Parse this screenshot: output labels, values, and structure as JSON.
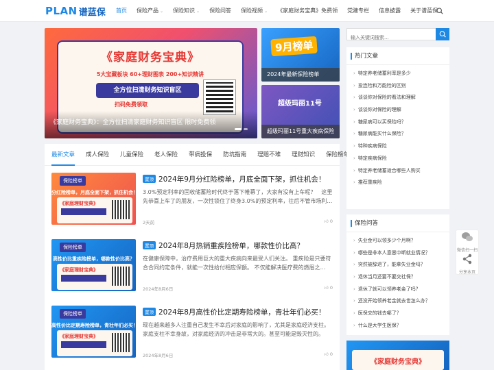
{
  "header": {
    "logo_plan": "PLAN",
    "logo_cn": "谱蓝保",
    "nav": [
      {
        "label": "首页",
        "caret": false,
        "active": true
      },
      {
        "label": "保险产品",
        "caret": true
      },
      {
        "label": "保险知识",
        "caret": true
      },
      {
        "label": "保险问答",
        "caret": false
      },
      {
        "label": "保险视频",
        "caret": true
      },
      {
        "label": "《家庭财务宝典》免费领",
        "caret": false
      },
      {
        "label": "党建专栏",
        "caret": false
      },
      {
        "label": "信息披露",
        "caret": false
      },
      {
        "label": "关于谱蓝保",
        "caret": true
      }
    ]
  },
  "slider": {
    "headline": "《家庭财务宝典》",
    "tagline": "5大宝藏板块 60+理财图表 200+知识精讲",
    "pill": "全方位扫清财务知识盲区",
    "sub": "扫码免费领取",
    "caption": "《家庭财务宝典》：全方位扫清家庭财务知识盲区 限时免费领"
  },
  "side_cards": [
    {
      "big": "9月榜单",
      "caption": "2024年最新保险榜单"
    },
    {
      "big": "超级玛丽11号",
      "caption": "超级玛丽11号重大疾病保险"
    }
  ],
  "tabs": [
    "最新文章",
    "成人保险",
    "儿童保险",
    "老人保险",
    "带病投保",
    "防坑指南",
    "理赔不难",
    "理财知识",
    "保险榜单"
  ],
  "articles": [
    {
      "thumb_badge": "保险榜单",
      "thumb_band": "分红险榜单，月底全面下架，抓住机会！",
      "thumb_mini": "《家庭理财宝典》",
      "tag": "置顶",
      "title": "2024年9月分红险榜单，月底全面下架，抓住机会！",
      "desc": "3.0%预定利率的固收储蓄险时代终于落下帷幕了，大家有没有上车呢？　这里先恭喜上车了的朋友，一次性锁住了终身3.0%的预定利率，往后不管市场利…",
      "date": "2天前",
      "likes": "0"
    },
    {
      "thumb_badge": "保险榜单",
      "thumb_band": "高性价比重疾险榜单，哪款性价比高？",
      "thumb_mini": "《家庭理财宝典》",
      "tag": "置顶",
      "title": "2024年8月热销重疾险榜单，哪款性价比高？",
      "desc": "在健康保障中，治疗费用巨大的重大疾病向来最受人们关注。 重疾险是只要符合合同约定条件，就能一次性给付相应保额。 不仅能解决医疗费的燃眉之…",
      "date": "2024年8月6日",
      "likes": "0"
    },
    {
      "thumb_badge": "保险榜单",
      "thumb_band": "高性价比定期寿险榜单，青壮年们必买！",
      "thumb_mini": "《家庭理财宝典》",
      "tag": "置顶",
      "title": "2024年8月高性价比定期寿险榜单，青壮年们必买！",
      "desc": "现在越来越多人注重自己发生不幸后对家庭的影响了，尤其是家庭经济支柱。家庭支柱不幸身故，对家庭经济的冲击是非常大的。甚至可能是毁灭性的。",
      "date": "2024年8月6日",
      "likes": "0"
    }
  ],
  "search": {
    "placeholder": "输入关键词搜索..."
  },
  "hot": {
    "title": "热门文章",
    "items": [
      "特定养老储蓄利率是多少",
      "投连险和万能险的区别",
      "谈谈你对保险的看法和理解",
      "谈谈你对保险的理解",
      "糖尿病可以买保险吗？",
      "糖尿病能买什么保险？",
      "特种疾病保险",
      "特定疾病保险",
      "特定养老储蓄适合哪些人购买",
      "推荐重疾险"
    ]
  },
  "qa": {
    "title": "保险问答",
    "items": [
      "失业金可以领多少个月啊？",
      "哪些是非本人意愿中断就业情况？",
      "突然被辞退了，能拿失业金吗？",
      "退休当月还要不要交社保？",
      "退休了就可以领养老金了吗？",
      "还没开始领养老金就去世怎么办？",
      "医保交的钱去哪了？",
      "什么是大学生医保？"
    ]
  },
  "ad": {
    "text": "《家庭财务宝典》"
  },
  "float": {
    "wechat": "微信扫一扫",
    "share": "分享本页"
  },
  "colors": {
    "accent": "#1e88e5",
    "orange": "#ff9800",
    "red": "#e53935",
    "navy": "#3a3a9e"
  }
}
